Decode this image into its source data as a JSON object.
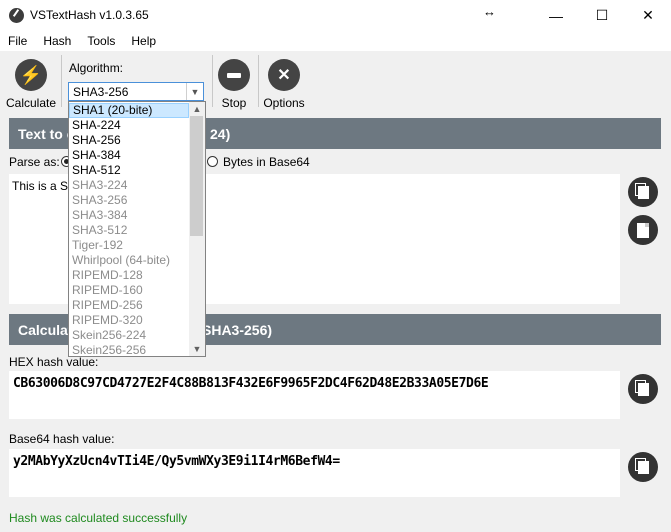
{
  "window": {
    "title": "VSTextHash v1.0.3.65",
    "minimize": "—",
    "maximize": "☐",
    "close": "✕",
    "resize_glyph": "↔"
  },
  "menu": [
    "File",
    "Hash",
    "Tools",
    "Help"
  ],
  "toolbar": {
    "calculate_label": "Calculate",
    "algorithm_label": "Algorithm:",
    "algorithm_selected": "SHA3-256",
    "stop_label": "Stop",
    "options_label": "Options"
  },
  "input_section": {
    "header_left": "Text to c",
    "header_right": "24)",
    "parse_as_label": "Parse as:",
    "option_base64": "Bytes in Base64",
    "text_value": "This is a Sof"
  },
  "dropdown": {
    "items": [
      {
        "label": "SHA1 (20-bite)",
        "state": "selected"
      },
      {
        "label": "SHA-224",
        "state": "normal"
      },
      {
        "label": "SHA-256",
        "state": "normal"
      },
      {
        "label": "SHA-384",
        "state": "normal"
      },
      {
        "label": "SHA-512",
        "state": "normal"
      },
      {
        "label": "SHA3-224",
        "state": "gray"
      },
      {
        "label": "SHA3-256",
        "state": "gray"
      },
      {
        "label": "SHA3-384",
        "state": "gray"
      },
      {
        "label": "SHA3-512",
        "state": "gray"
      },
      {
        "label": "Tiger-192",
        "state": "gray"
      },
      {
        "label": "Whirlpool (64-bite)",
        "state": "gray"
      },
      {
        "label": "RIPEMD-128",
        "state": "gray"
      },
      {
        "label": "RIPEMD-160",
        "state": "gray"
      },
      {
        "label": "RIPEMD-256",
        "state": "gray"
      },
      {
        "label": "RIPEMD-320",
        "state": "gray"
      },
      {
        "label": "Skein256-224",
        "state": "gray"
      },
      {
        "label": "Skein256-256",
        "state": "gray"
      }
    ]
  },
  "result_section": {
    "header_left": "Calculate",
    "header_right": "SHA3-256)",
    "hex_label": "HEX hash value:",
    "hex_value": "CB63006D8C97CD4727E2F4C88B813F432E6F9965F2DC4F62D48E2B33A05E7D6E",
    "base64_label": "Base64 hash value:",
    "base64_value": "y2MAbYyXzUcn4vTIi4E/Qy5vmWXy3E9i1I4rM6BefW4="
  },
  "status": {
    "text": "Hash was calculated successfully",
    "color": "#1f8a1f"
  },
  "colors": {
    "section_header": "#6d7881",
    "select_border": "#4a90d9",
    "dropdown_selected": "#cce8ff"
  },
  "icons": {
    "calculate": "lightning-icon",
    "stop": "stop-icon",
    "options": "tools-icon",
    "copy": "copy-icon",
    "paste": "document-icon"
  }
}
